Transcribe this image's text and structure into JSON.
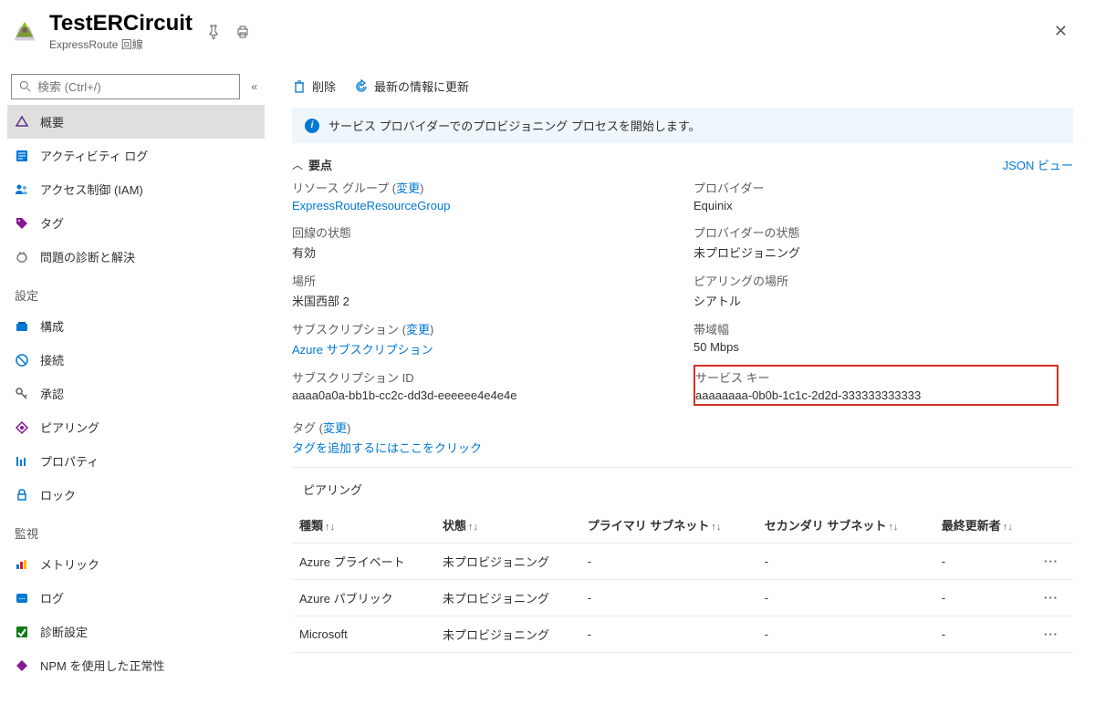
{
  "header": {
    "title": "TestERCircuit",
    "subtitle": "ExpressRoute 回線"
  },
  "search": {
    "placeholder": "検索 (Ctrl+/)"
  },
  "sidebar": {
    "top": [
      {
        "label": "概要"
      },
      {
        "label": "アクティビティ ログ"
      },
      {
        "label": "アクセス制御 (IAM)"
      },
      {
        "label": "タグ"
      },
      {
        "label": "問題の診断と解決"
      }
    ],
    "section_settings": "設定",
    "settings": [
      {
        "label": "構成"
      },
      {
        "label": "接続"
      },
      {
        "label": "承認"
      },
      {
        "label": "ピアリング"
      },
      {
        "label": "プロパティ"
      },
      {
        "label": "ロック"
      }
    ],
    "section_monitor": "監視",
    "monitor": [
      {
        "label": "メトリック"
      },
      {
        "label": "ログ"
      },
      {
        "label": "診断設定"
      },
      {
        "label": "NPM を使用した正常性"
      }
    ]
  },
  "toolbar": {
    "delete": "削除",
    "refresh": "最新の情報に更新"
  },
  "banner": {
    "text": "サービス プロバイダーでのプロビジョニング プロセスを開始します。"
  },
  "essentials": {
    "title": "要点",
    "json_view": "JSON ビュー",
    "change": "変更",
    "left": {
      "rg_label": "リソース グループ",
      "rg_value": "ExpressRouteResourceGroup",
      "circuit_status_label": "回線の状態",
      "circuit_status_value": "有効",
      "location_label": "場所",
      "location_value": "米国西部 2",
      "sub_label": "サブスクリプション",
      "sub_value": "Azure サブスクリプション",
      "subid_label": "サブスクリプション ID",
      "subid_value": "aaaa0a0a-bb1b-cc2c-dd3d-eeeeee4e4e4e"
    },
    "right": {
      "provider_label": "プロバイダー",
      "provider_value": "Equinix",
      "provider_status_label": "プロバイダーの状態",
      "provider_status_value": "未プロビジョニング",
      "peering_loc_label": "ピアリングの場所",
      "peering_loc_value": "シアトル",
      "bandwidth_label": "帯域幅",
      "bandwidth_value": "50 Mbps",
      "service_key_label": "サービス キー",
      "service_key_value": "aaaaaaaa-0b0b-1c1c-2d2d-333333333333"
    },
    "tags_label": "タグ",
    "tags_cta": "タグを追加するにはここをクリック"
  },
  "peerings": {
    "title": "ピアリング",
    "columns": {
      "type": "種類",
      "state": "状態",
      "primary_subnet": "プライマリ サブネット",
      "secondary_subnet": "セカンダリ サブネット",
      "last_modified_by": "最終更新者"
    },
    "rows": [
      {
        "type": "Azure プライベート",
        "state": "未プロビジョニング",
        "primary": "-",
        "secondary": "-",
        "last": "-"
      },
      {
        "type": "Azure パブリック",
        "state": "未プロビジョニング",
        "primary": "-",
        "secondary": "-",
        "last": "-"
      },
      {
        "type": "Microsoft",
        "state": "未プロビジョニング",
        "primary": "-",
        "secondary": "-",
        "last": "-"
      }
    ]
  }
}
